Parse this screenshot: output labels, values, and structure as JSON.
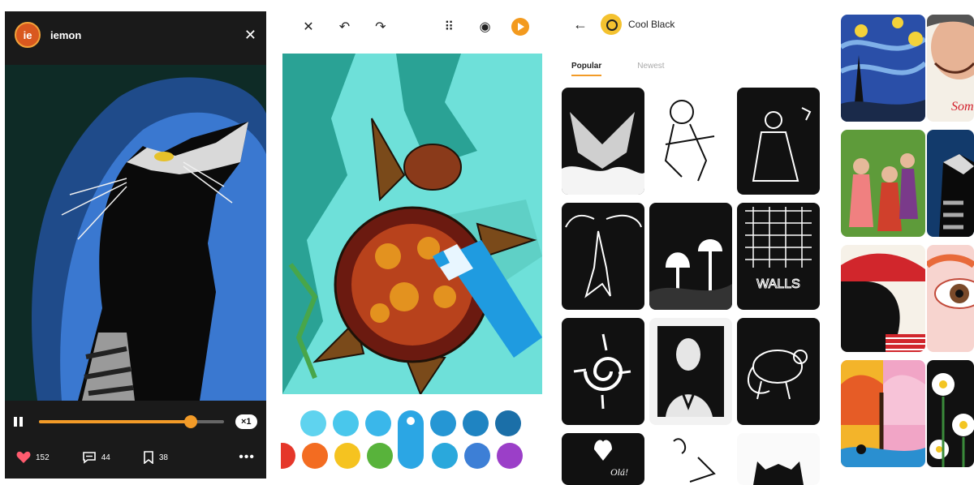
{
  "player": {
    "avatar_text": "ie",
    "username": "iemon",
    "speed": "×1",
    "progress": 0.82,
    "likes": "152",
    "comments": "44",
    "saves": "38",
    "icons": [
      "close-icon",
      "pause-icon",
      "heart-icon",
      "comment-icon",
      "bookmark-icon",
      "more-icon"
    ]
  },
  "coloring": {
    "toolbar_icons": [
      "close-icon",
      "undo-icon",
      "redo-icon",
      "grid-icon",
      "eye-icon",
      "play-icon"
    ],
    "palette": [
      "#5fd3ef",
      "#49c7ec",
      "#3ab7ea",
      "#2ba6e4",
      "#2596d4",
      "#1f84c2",
      "#1b6fa8",
      "#e5372a",
      "#f36c21",
      "#f5c320",
      "#58b33b",
      "#2aa8dc",
      "#3d7fd6",
      "#9b3fc8"
    ],
    "selected_color": "#2ba6e4"
  },
  "gallery": {
    "title": "Cool Black",
    "tabs": [
      {
        "label": "Popular",
        "active": true
      },
      {
        "label": "Newest",
        "active": false
      }
    ],
    "thumb_captions": [
      "WALLS",
      "Olá!"
    ],
    "accent": "#f29b28"
  },
  "side_gallery": {
    "captions": [
      "Som"
    ]
  }
}
